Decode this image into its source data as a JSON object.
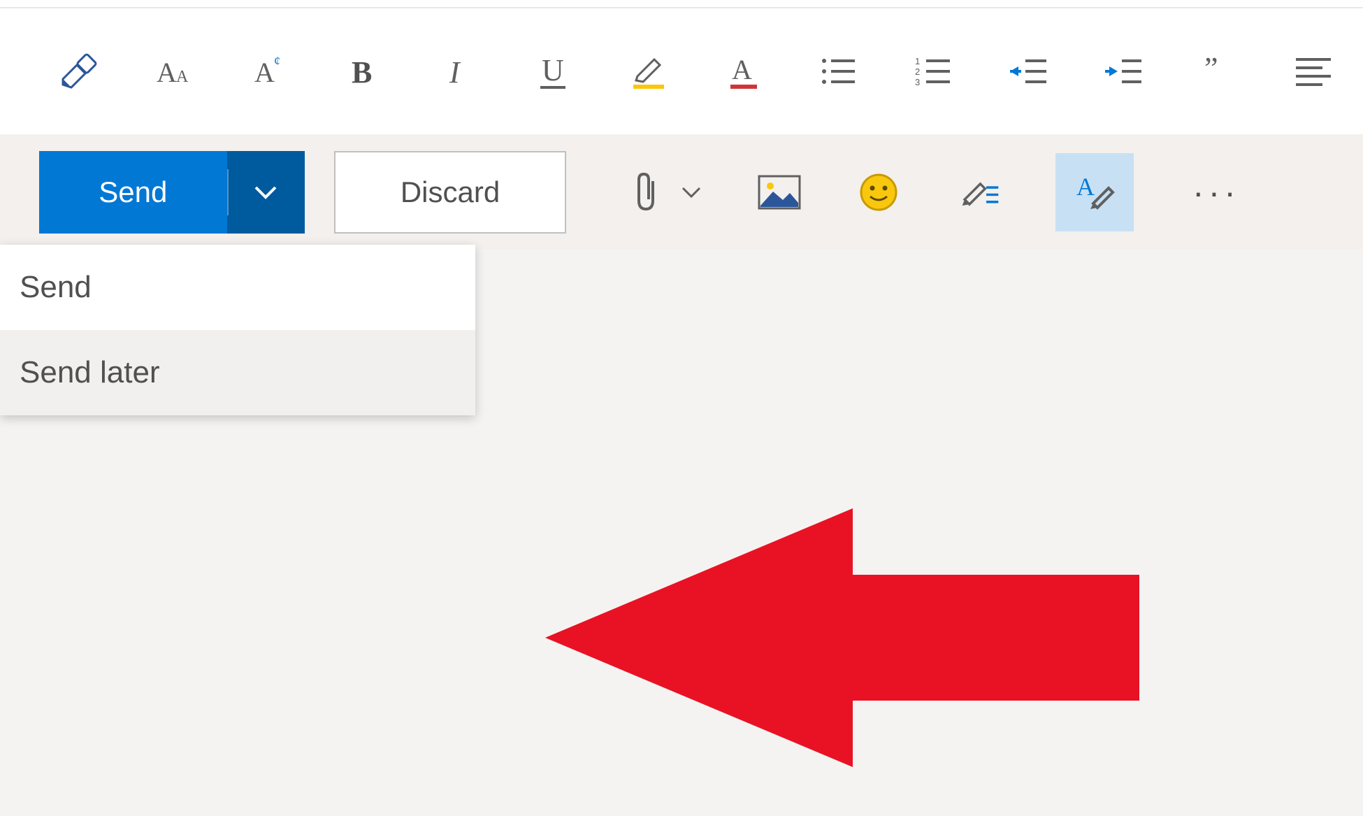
{
  "formatting_toolbar": {
    "icons": [
      "format-painter-icon",
      "font-size-icon",
      "clear-formatting-icon",
      "bold-icon",
      "italic-icon",
      "underline-icon",
      "highlight-icon",
      "font-color-icon",
      "bulleted-list-icon",
      "numbered-list-icon",
      "decrease-indent-icon",
      "increase-indent-icon",
      "quote-icon",
      "align-icon"
    ]
  },
  "action_toolbar": {
    "send_label": "Send",
    "discard_label": "Discard",
    "send_menu": {
      "option_send": "Send",
      "option_send_later": "Send later"
    }
  },
  "colors": {
    "primary": "#0078d4",
    "primary_dark": "#005a9e",
    "highlight": "#c7e0f4",
    "annotation_arrow": "#e81224"
  }
}
